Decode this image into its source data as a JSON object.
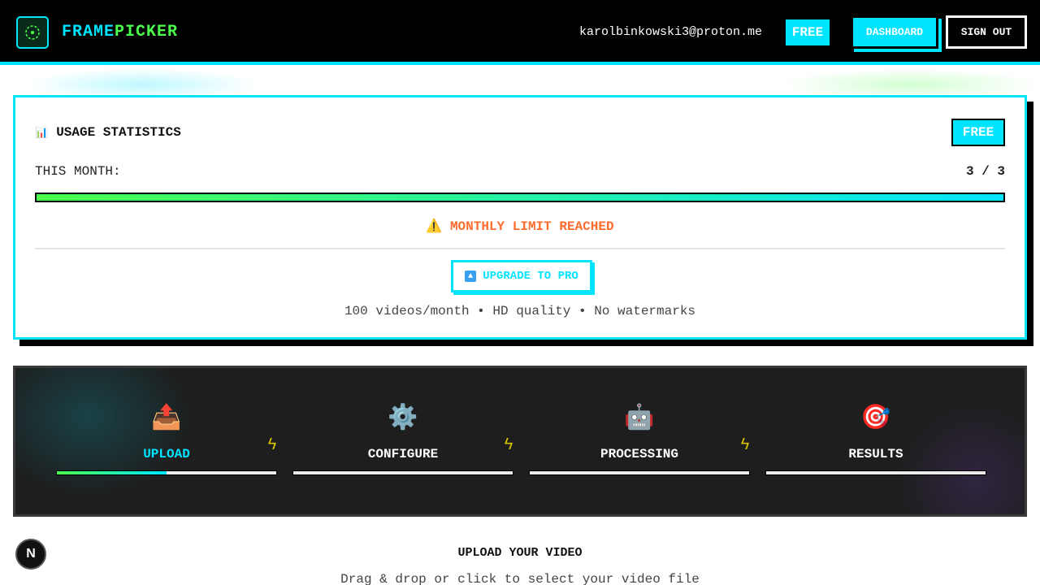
{
  "header": {
    "brand_part1": "FRAME",
    "brand_part2": "PICKER",
    "email": "karolbinkowski3@proton.me",
    "plan": "FREE",
    "dashboard_label": "DASHBOARD",
    "signout_label": "SIGN OUT",
    "logo_icon": "target-icon"
  },
  "usage": {
    "title": "USAGE STATISTICS",
    "title_icon": "chart-icon",
    "badge": "FREE",
    "month_label": "THIS MONTH:",
    "count": "3 / 3",
    "progress": 1.0,
    "limit_text": "MONTHLY LIMIT REACHED",
    "limit_icon": "warning-icon",
    "upgrade_label": "UPGRADE TO PRO",
    "upgrade_icon": "up-arrow-icon",
    "upgrade_note": "100 videos/month • HD quality • No watermarks"
  },
  "steps": [
    {
      "label": "UPLOAD",
      "icon": "outbox-tray-icon",
      "active": true,
      "progress": 0.5
    },
    {
      "label": "CONFIGURE",
      "icon": "gear-icon",
      "active": false,
      "progress": 0
    },
    {
      "label": "PROCESSING",
      "icon": "robot-icon",
      "active": false,
      "progress": 0
    },
    {
      "label": "RESULTS",
      "icon": "target-icon",
      "active": false,
      "progress": 0
    }
  ],
  "upload": {
    "title": "UPLOAD YOUR VIDEO",
    "subtitle": "Drag & drop or click to select your video file"
  },
  "colors": {
    "accent_cyan": "#00e5ff",
    "accent_green": "#4cff4c",
    "warning": "#ff6b2c"
  }
}
